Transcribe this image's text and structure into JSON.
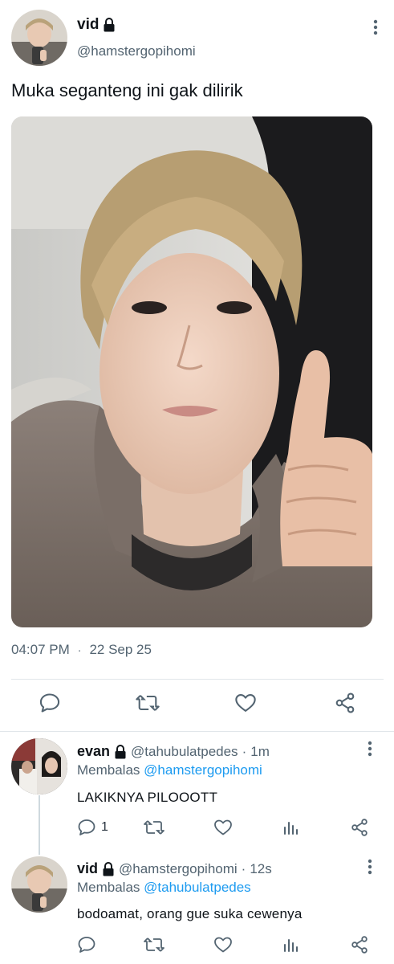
{
  "post": {
    "display_name": "vid",
    "handle": "@hamstergopihomi",
    "text": "Muka seganteng ini gak dilirik",
    "time": "04:07 PM",
    "separator": "·",
    "date": "22 Sep 25"
  },
  "replies": [
    {
      "display_name": "evan",
      "handle": "@tahubulatpedes",
      "separator": "·",
      "age": "1m",
      "replying_prefix": "Membalas",
      "replying_to": "@hamstergopihomi",
      "text": "LAKIKNYA PILOOOTT",
      "reply_count": "1"
    },
    {
      "display_name": "vid",
      "handle": "@hamstergopihomi",
      "separator": "·",
      "age": "12s",
      "replying_prefix": "Membalas",
      "replying_to": "@tahubulatpedes",
      "text": "bodoamat, orang gue suka cewenya",
      "reply_count": ""
    }
  ],
  "icons": {
    "lock": "lock-icon",
    "more": "more-vertical-icon",
    "reply": "reply-icon",
    "retweet": "retweet-icon",
    "like": "heart-icon",
    "views": "views-chart-icon",
    "share": "share-icon"
  },
  "colors": {
    "text": "#0f1419",
    "secondary": "#536471",
    "link": "#1d9bf0",
    "divider": "#e1e6ea"
  }
}
